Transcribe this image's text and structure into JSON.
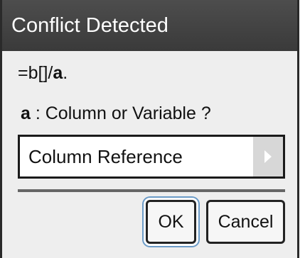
{
  "dialog": {
    "title": "Conflict Detected",
    "formula_prefix": "=b[]/",
    "formula_var": "a",
    "formula_suffix": ".",
    "question_var": "a",
    "question_text": ":  Column or Variable ?",
    "selection": {
      "value": "Column Reference"
    },
    "buttons": {
      "ok": "OK",
      "cancel": "Cancel"
    }
  },
  "icons": {
    "dropdown": "triangle-right-icon"
  },
  "colors": {
    "title_bar": "#3f3f3f",
    "focus_ring": "#6b9bc7"
  }
}
